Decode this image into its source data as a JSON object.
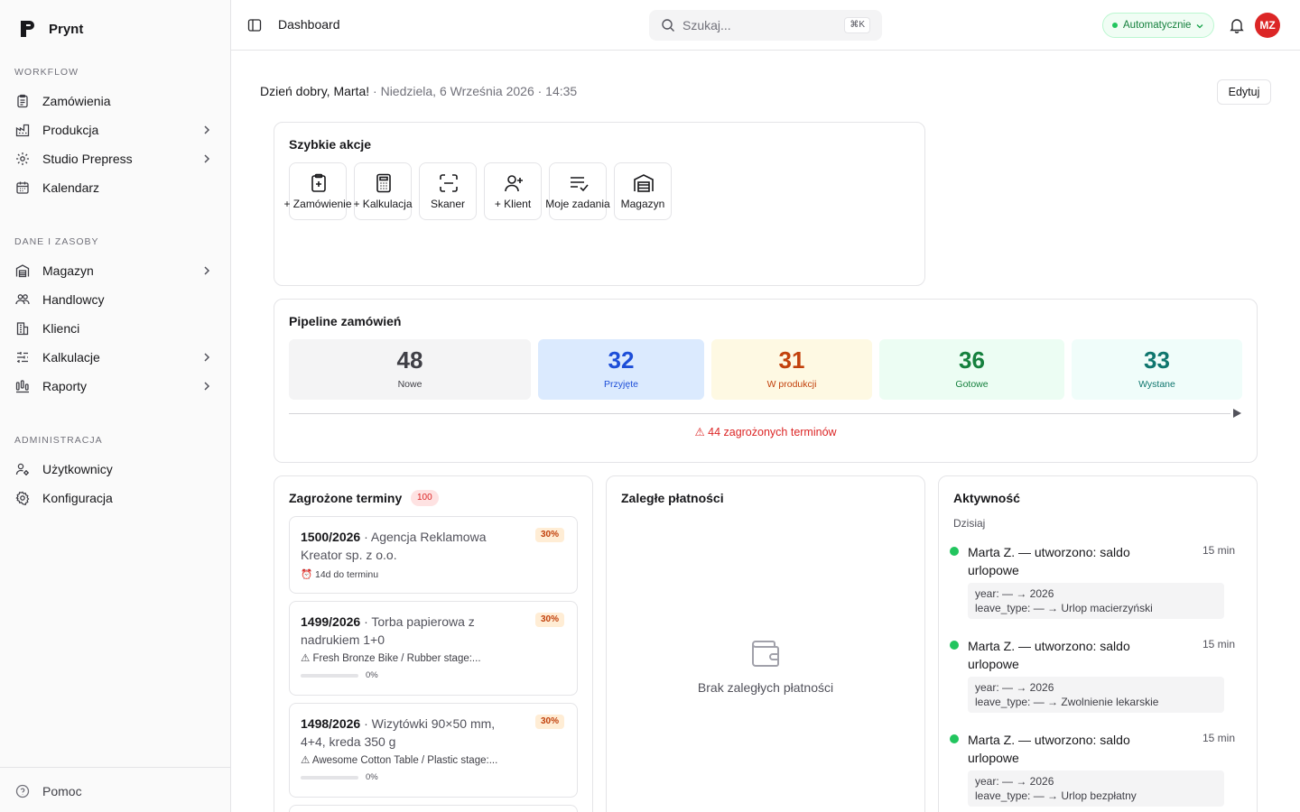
{
  "app": {
    "name": "Prynt"
  },
  "sidebar": {
    "sections": [
      {
        "title": "WORKFLOW",
        "items": [
          {
            "label": "Zamówienia",
            "icon": "clipboard-icon"
          },
          {
            "label": "Produkcja",
            "icon": "factory-icon"
          },
          {
            "label": "Studio Prepress",
            "icon": "sparkle-icon"
          },
          {
            "label": "Kalendarz",
            "icon": "calendar-icon"
          }
        ]
      },
      {
        "title": "DANE I ZASOBY",
        "items": [
          {
            "label": "Magazyn",
            "icon": "warehouse-icon"
          },
          {
            "label": "Handlowcy",
            "icon": "users-icon"
          },
          {
            "label": "Klienci",
            "icon": "building-icon"
          },
          {
            "label": "Kalkulacje",
            "icon": "sliders-icon"
          },
          {
            "label": "Raporty",
            "icon": "chart-icon"
          }
        ]
      },
      {
        "title": "ADMINISTRACJA",
        "items": [
          {
            "label": "Użytkownicy",
            "icon": "user-cog-icon"
          },
          {
            "label": "Konfiguracja",
            "icon": "gear-icon"
          }
        ]
      }
    ],
    "help_label": "Pomoc"
  },
  "topbar": {
    "breadcrumb": "Dashboard",
    "search_placeholder": "Szukaj...",
    "search_shortcut": "⌘K",
    "mode_label": "Automatycznie",
    "avatar_initials": "MZ"
  },
  "greeting": {
    "hello": "Dzień dobry, Marta!",
    "date": "Niedziela, 6 Września 2026 · 14:35"
  },
  "edit_label": "Edytuj",
  "quick_actions": {
    "title": "Szybkie akcje",
    "items": [
      {
        "label": "+ Zamówienie",
        "icon": "clipboard-plus-icon"
      },
      {
        "label": "+ Kalkulacja",
        "icon": "calculator-icon"
      },
      {
        "label": "Skaner",
        "icon": "scan-icon"
      },
      {
        "label": "+ Klient",
        "icon": "user-plus-icon"
      },
      {
        "label": "Moje zadania",
        "icon": "list-check-icon"
      },
      {
        "label": "Magazyn",
        "icon": "warehouse-icon"
      }
    ]
  },
  "pipeline": {
    "title": "Pipeline zamówień",
    "stages": [
      {
        "count": "48",
        "label": "Nowe",
        "bg": "#f4f4f5",
        "color": "#3f3f46"
      },
      {
        "count": "32",
        "label": "Przyjęte",
        "bg": "#dbeafe",
        "color": "#1d4ed8"
      },
      {
        "count": "31",
        "label": "W produkcji",
        "bg": "#fef9e3",
        "color": "#c2410c"
      },
      {
        "count": "36",
        "label": "Gotowe",
        "bg": "#ecfdf3",
        "color": "#15803d"
      },
      {
        "count": "33",
        "label": "Wystane",
        "bg": "#f0fdfa",
        "color": "#0f766e"
      }
    ],
    "warning": "⚠ 44 zagrożonych terminów"
  },
  "at_risk": {
    "title": "Zagrożone terminy",
    "count": "100",
    "items": [
      {
        "number": "1500/2026",
        "name": " · Agencja Reklamowa Kreator sp. z o.o.",
        "pct": "30%",
        "sub": "⏰ 14d do terminu"
      },
      {
        "number": "1499/2026",
        "name": " · Torba papierowa z nadrukiem 1+0",
        "pct": "30%",
        "sub": "⚠ Fresh Bronze Bike / Rubber stage:...",
        "progress": "0%"
      },
      {
        "number": "1498/2026",
        "name": " · Wizytówki 90×50 mm, 4+4, kreda 350 g",
        "pct": "30%",
        "sub": "⚠ Awesome Cotton Table / Plastic stage:...",
        "progress": "0%"
      }
    ]
  },
  "payments": {
    "title": "Zaległe płatności",
    "empty": "Brak zaległych płatności"
  },
  "activity": {
    "title": "Aktywność",
    "group": "Dzisiaj",
    "items": [
      {
        "text": "Marta Z. — utworzono: saldo urlopowe",
        "time": "15 min",
        "line1": "year: — → 2026",
        "line2": "leave_type: — → Urlop macierzyński"
      },
      {
        "text": "Marta Z. — utworzono: saldo urlopowe",
        "time": "15 min",
        "line1": "year: — → 2026",
        "line2": "leave_type: — → Zwolnienie lekarskie"
      },
      {
        "text": "Marta Z. — utworzono: saldo urlopowe",
        "time": "15 min",
        "line1": "year: — → 2026",
        "line2": "leave_type: — → Urlop bezpłatny"
      }
    ]
  }
}
